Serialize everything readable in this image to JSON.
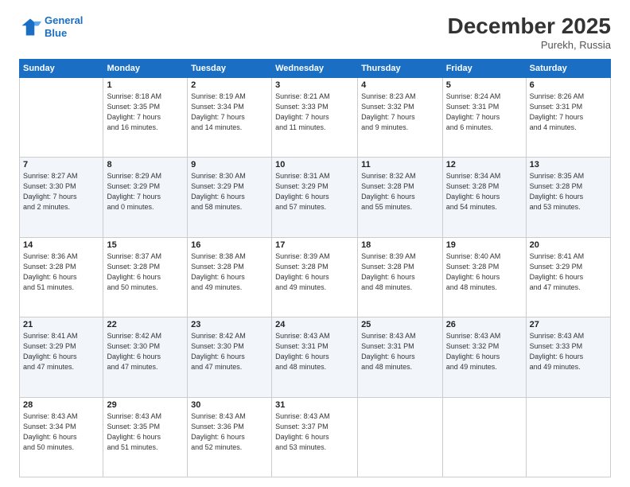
{
  "header": {
    "logo_line1": "General",
    "logo_line2": "Blue",
    "month": "December 2025",
    "location": "Purekh, Russia"
  },
  "days_of_week": [
    "Sunday",
    "Monday",
    "Tuesday",
    "Wednesday",
    "Thursday",
    "Friday",
    "Saturday"
  ],
  "weeks": [
    [
      {
        "day": "",
        "info": ""
      },
      {
        "day": "1",
        "info": "Sunrise: 8:18 AM\nSunset: 3:35 PM\nDaylight: 7 hours\nand 16 minutes."
      },
      {
        "day": "2",
        "info": "Sunrise: 8:19 AM\nSunset: 3:34 PM\nDaylight: 7 hours\nand 14 minutes."
      },
      {
        "day": "3",
        "info": "Sunrise: 8:21 AM\nSunset: 3:33 PM\nDaylight: 7 hours\nand 11 minutes."
      },
      {
        "day": "4",
        "info": "Sunrise: 8:23 AM\nSunset: 3:32 PM\nDaylight: 7 hours\nand 9 minutes."
      },
      {
        "day": "5",
        "info": "Sunrise: 8:24 AM\nSunset: 3:31 PM\nDaylight: 7 hours\nand 6 minutes."
      },
      {
        "day": "6",
        "info": "Sunrise: 8:26 AM\nSunset: 3:31 PM\nDaylight: 7 hours\nand 4 minutes."
      }
    ],
    [
      {
        "day": "7",
        "info": "Sunrise: 8:27 AM\nSunset: 3:30 PM\nDaylight: 7 hours\nand 2 minutes."
      },
      {
        "day": "8",
        "info": "Sunrise: 8:29 AM\nSunset: 3:29 PM\nDaylight: 7 hours\nand 0 minutes."
      },
      {
        "day": "9",
        "info": "Sunrise: 8:30 AM\nSunset: 3:29 PM\nDaylight: 6 hours\nand 58 minutes."
      },
      {
        "day": "10",
        "info": "Sunrise: 8:31 AM\nSunset: 3:29 PM\nDaylight: 6 hours\nand 57 minutes."
      },
      {
        "day": "11",
        "info": "Sunrise: 8:32 AM\nSunset: 3:28 PM\nDaylight: 6 hours\nand 55 minutes."
      },
      {
        "day": "12",
        "info": "Sunrise: 8:34 AM\nSunset: 3:28 PM\nDaylight: 6 hours\nand 54 minutes."
      },
      {
        "day": "13",
        "info": "Sunrise: 8:35 AM\nSunset: 3:28 PM\nDaylight: 6 hours\nand 53 minutes."
      }
    ],
    [
      {
        "day": "14",
        "info": "Sunrise: 8:36 AM\nSunset: 3:28 PM\nDaylight: 6 hours\nand 51 minutes."
      },
      {
        "day": "15",
        "info": "Sunrise: 8:37 AM\nSunset: 3:28 PM\nDaylight: 6 hours\nand 50 minutes."
      },
      {
        "day": "16",
        "info": "Sunrise: 8:38 AM\nSunset: 3:28 PM\nDaylight: 6 hours\nand 49 minutes."
      },
      {
        "day": "17",
        "info": "Sunrise: 8:39 AM\nSunset: 3:28 PM\nDaylight: 6 hours\nand 49 minutes."
      },
      {
        "day": "18",
        "info": "Sunrise: 8:39 AM\nSunset: 3:28 PM\nDaylight: 6 hours\nand 48 minutes."
      },
      {
        "day": "19",
        "info": "Sunrise: 8:40 AM\nSunset: 3:28 PM\nDaylight: 6 hours\nand 48 minutes."
      },
      {
        "day": "20",
        "info": "Sunrise: 8:41 AM\nSunset: 3:29 PM\nDaylight: 6 hours\nand 47 minutes."
      }
    ],
    [
      {
        "day": "21",
        "info": "Sunrise: 8:41 AM\nSunset: 3:29 PM\nDaylight: 6 hours\nand 47 minutes."
      },
      {
        "day": "22",
        "info": "Sunrise: 8:42 AM\nSunset: 3:30 PM\nDaylight: 6 hours\nand 47 minutes."
      },
      {
        "day": "23",
        "info": "Sunrise: 8:42 AM\nSunset: 3:30 PM\nDaylight: 6 hours\nand 47 minutes."
      },
      {
        "day": "24",
        "info": "Sunrise: 8:43 AM\nSunset: 3:31 PM\nDaylight: 6 hours\nand 48 minutes."
      },
      {
        "day": "25",
        "info": "Sunrise: 8:43 AM\nSunset: 3:31 PM\nDaylight: 6 hours\nand 48 minutes."
      },
      {
        "day": "26",
        "info": "Sunrise: 8:43 AM\nSunset: 3:32 PM\nDaylight: 6 hours\nand 49 minutes."
      },
      {
        "day": "27",
        "info": "Sunrise: 8:43 AM\nSunset: 3:33 PM\nDaylight: 6 hours\nand 49 minutes."
      }
    ],
    [
      {
        "day": "28",
        "info": "Sunrise: 8:43 AM\nSunset: 3:34 PM\nDaylight: 6 hours\nand 50 minutes."
      },
      {
        "day": "29",
        "info": "Sunrise: 8:43 AM\nSunset: 3:35 PM\nDaylight: 6 hours\nand 51 minutes."
      },
      {
        "day": "30",
        "info": "Sunrise: 8:43 AM\nSunset: 3:36 PM\nDaylight: 6 hours\nand 52 minutes."
      },
      {
        "day": "31",
        "info": "Sunrise: 8:43 AM\nSunset: 3:37 PM\nDaylight: 6 hours\nand 53 minutes."
      },
      {
        "day": "",
        "info": ""
      },
      {
        "day": "",
        "info": ""
      },
      {
        "day": "",
        "info": ""
      }
    ]
  ]
}
